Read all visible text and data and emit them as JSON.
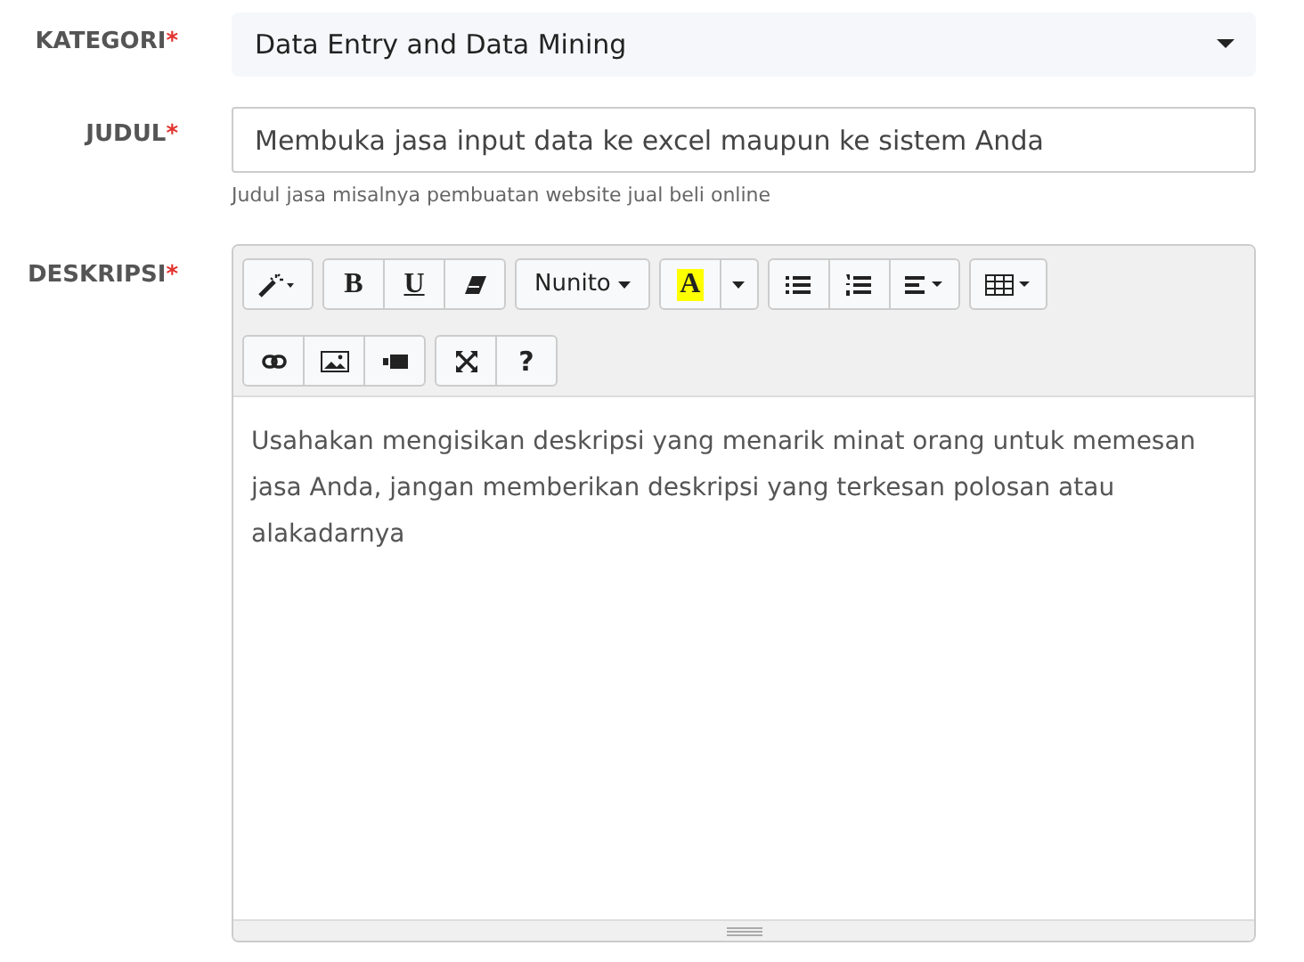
{
  "kategori": {
    "label": "KATEGORI",
    "required_mark": "*",
    "value": "Data Entry and Data Mining"
  },
  "judul": {
    "label": "JUDUL",
    "required_mark": "*",
    "value": "Membuka jasa input data ke excel maupun ke sistem Anda",
    "help": "Judul jasa misalnya pembuatan website jual beli online"
  },
  "deskripsi": {
    "label": "DESKRIPSI",
    "required_mark": "*",
    "toolbar": {
      "font": "Nunito",
      "color_letter": "A",
      "help_button": "?",
      "bold": "B",
      "underline": "U"
    },
    "value": "Usahakan mengisikan deskripsi yang menarik minat orang untuk memesan jasa Anda, jangan memberikan deskripsi yang terkesan polosan atau alakadarnya"
  }
}
